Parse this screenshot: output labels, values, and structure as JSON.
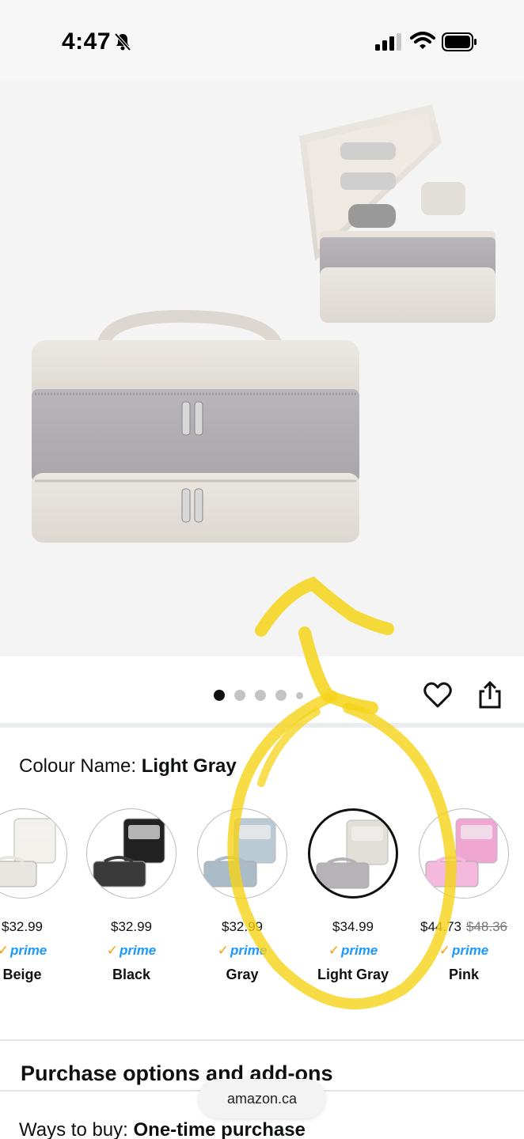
{
  "status_bar": {
    "time": "4:47"
  },
  "gallery": {
    "dot_count": 5,
    "active_index": 0
  },
  "colour": {
    "label": "Colour Name:",
    "selected": "Light Gray"
  },
  "swatches": [
    {
      "name": "Beige",
      "price": "$32.99",
      "prime": "prime",
      "body": "#f3f1ec",
      "panel": "#e8e6e1"
    },
    {
      "name": "Black",
      "price": "$32.99",
      "prime": "prime",
      "body": "#222222",
      "panel": "#3a3a3a"
    },
    {
      "name": "Gray",
      "price": "$32.99",
      "prime": "prime",
      "body": "#b9cad4",
      "panel": "#a9bcc8"
    },
    {
      "name": "Light Gray",
      "price": "$34.99",
      "prime": "prime",
      "body": "#e2ded8",
      "panel": "#b5b3b6"
    },
    {
      "name": "Pink",
      "price": "$44.73",
      "old_price": "$48.36",
      "prime": "prime",
      "body": "#f0a6d3",
      "panel": "#f4b9dc"
    }
  ],
  "sections": {
    "purchase_title": "Purchase options and add-ons",
    "ways_label": "Ways to buy:",
    "ways_value": "One-time purchase"
  },
  "browser": {
    "url": "amazon.ca"
  },
  "colors": {
    "highlight": "#f5d318",
    "prime_blue": "#1a98ff",
    "prime_check": "#ff9900"
  }
}
